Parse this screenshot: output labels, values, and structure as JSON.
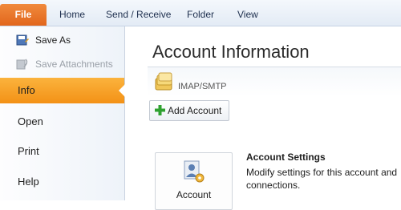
{
  "ribbon": {
    "file_tab": "File",
    "tabs": [
      "Home",
      "Send / Receive",
      "Folder",
      "View"
    ]
  },
  "sidebar": {
    "commands": [
      {
        "label": "Save As",
        "icon": "save-as-icon",
        "enabled": true
      },
      {
        "label": "Save Attachments",
        "icon": "save-attachments-icon",
        "enabled": false
      }
    ],
    "nav": [
      "Info",
      "Open",
      "Print",
      "Help"
    ],
    "selected": "Info"
  },
  "main": {
    "title": "Account Information",
    "account_type": "IMAP/SMTP",
    "add_account_label": "Add Account",
    "account_settings": {
      "button_label": "Account",
      "title": "Account Settings",
      "description": "Modify settings for this account and connections."
    }
  },
  "colors": {
    "file_tab": "#e2661c",
    "selected_nav": "#f5a024",
    "add_plus": "#2fa12f"
  }
}
